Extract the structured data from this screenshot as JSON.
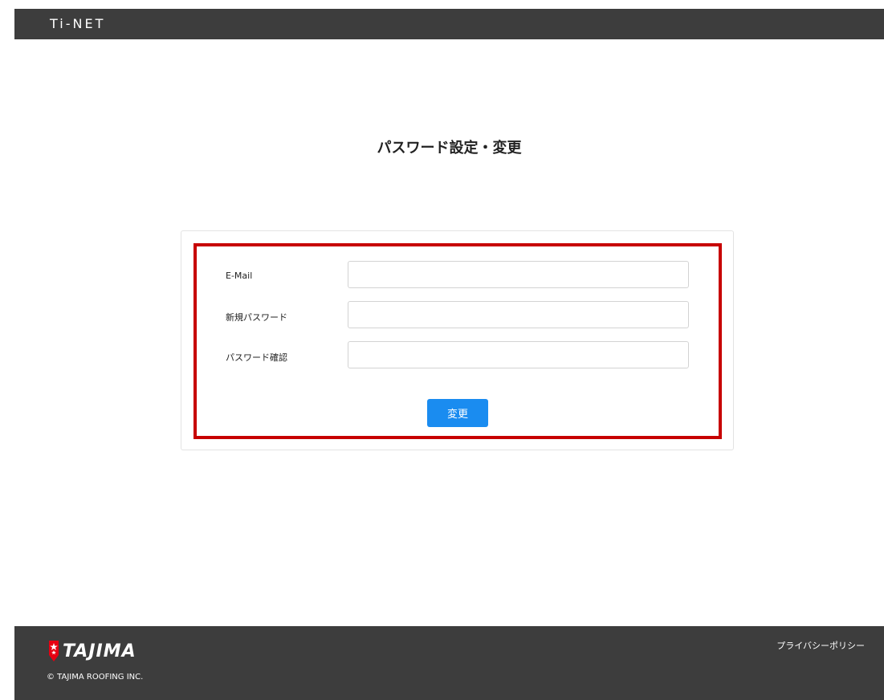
{
  "header": {
    "brand": "Ti-NET"
  },
  "page": {
    "title": "パスワード設定・変更"
  },
  "form": {
    "email_label": "E-Mail",
    "email_value": "",
    "new_password_label": "新規パスワード",
    "new_password_value": "",
    "confirm_password_label": "パスワード確認",
    "confirm_password_value": "",
    "submit_label": "変更"
  },
  "footer": {
    "logo_text": "TAJIMA",
    "copyright": "© TAJIMA ROOFING INC.",
    "privacy_link": "プライバシーポリシー"
  },
  "colors": {
    "bar": "#3d3d3d",
    "highlight": "#c70000",
    "button": "#1a8cf0",
    "logo_flag": "#e60012"
  }
}
